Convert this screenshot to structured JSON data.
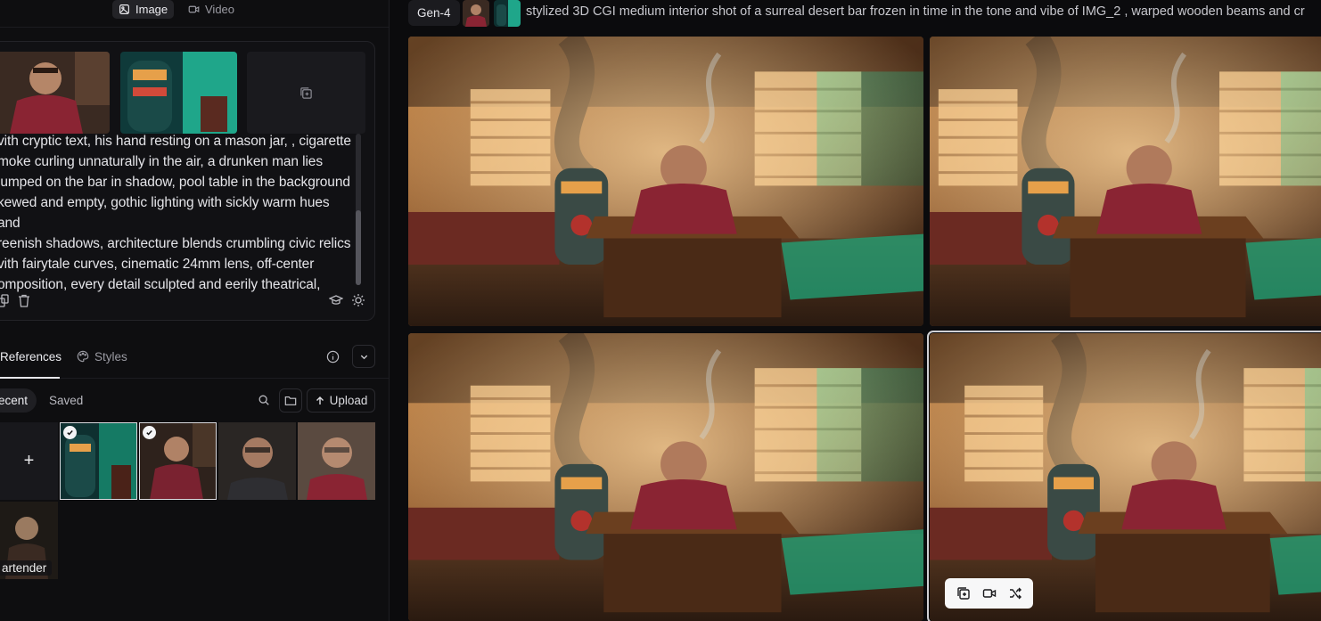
{
  "mode_tabs": {
    "image": "Image",
    "video": "Video"
  },
  "prompt": {
    "lines": [
      "vith cryptic text, his hand resting on a mason jar, , cigarette",
      "moke curling unnaturally in the air, a drunken man lies",
      "lumped on the bar in shadow, pool table in the background",
      "kewed and empty, gothic lighting with sickly warm hues and",
      "reenish shadows, architecture blends crumbling civic relics",
      "vith fairytale curves, cinematic 24mm lens, off-center",
      "omposition, every detail sculpted and eerily theatrical,"
    ]
  },
  "references": {
    "tab_references": "References",
    "tab_styles": "Styles",
    "filter_recent": "ecent",
    "filter_saved": "Saved",
    "upload": "Upload",
    "add_symbol": "+",
    "labeled_thumb": "artender"
  },
  "generation": {
    "model": "Gen-4",
    "prompt": "stylized 3D CGI medium interior shot of a surreal desert bar frozen in time in the tone and vibe of IMG_2 , warped wooden beams and cr"
  },
  "colors": {
    "panel": "#0e0e10",
    "accent_green": "#1fa67a",
    "apron": "#8a2433",
    "wood": "#6b3f1f"
  }
}
